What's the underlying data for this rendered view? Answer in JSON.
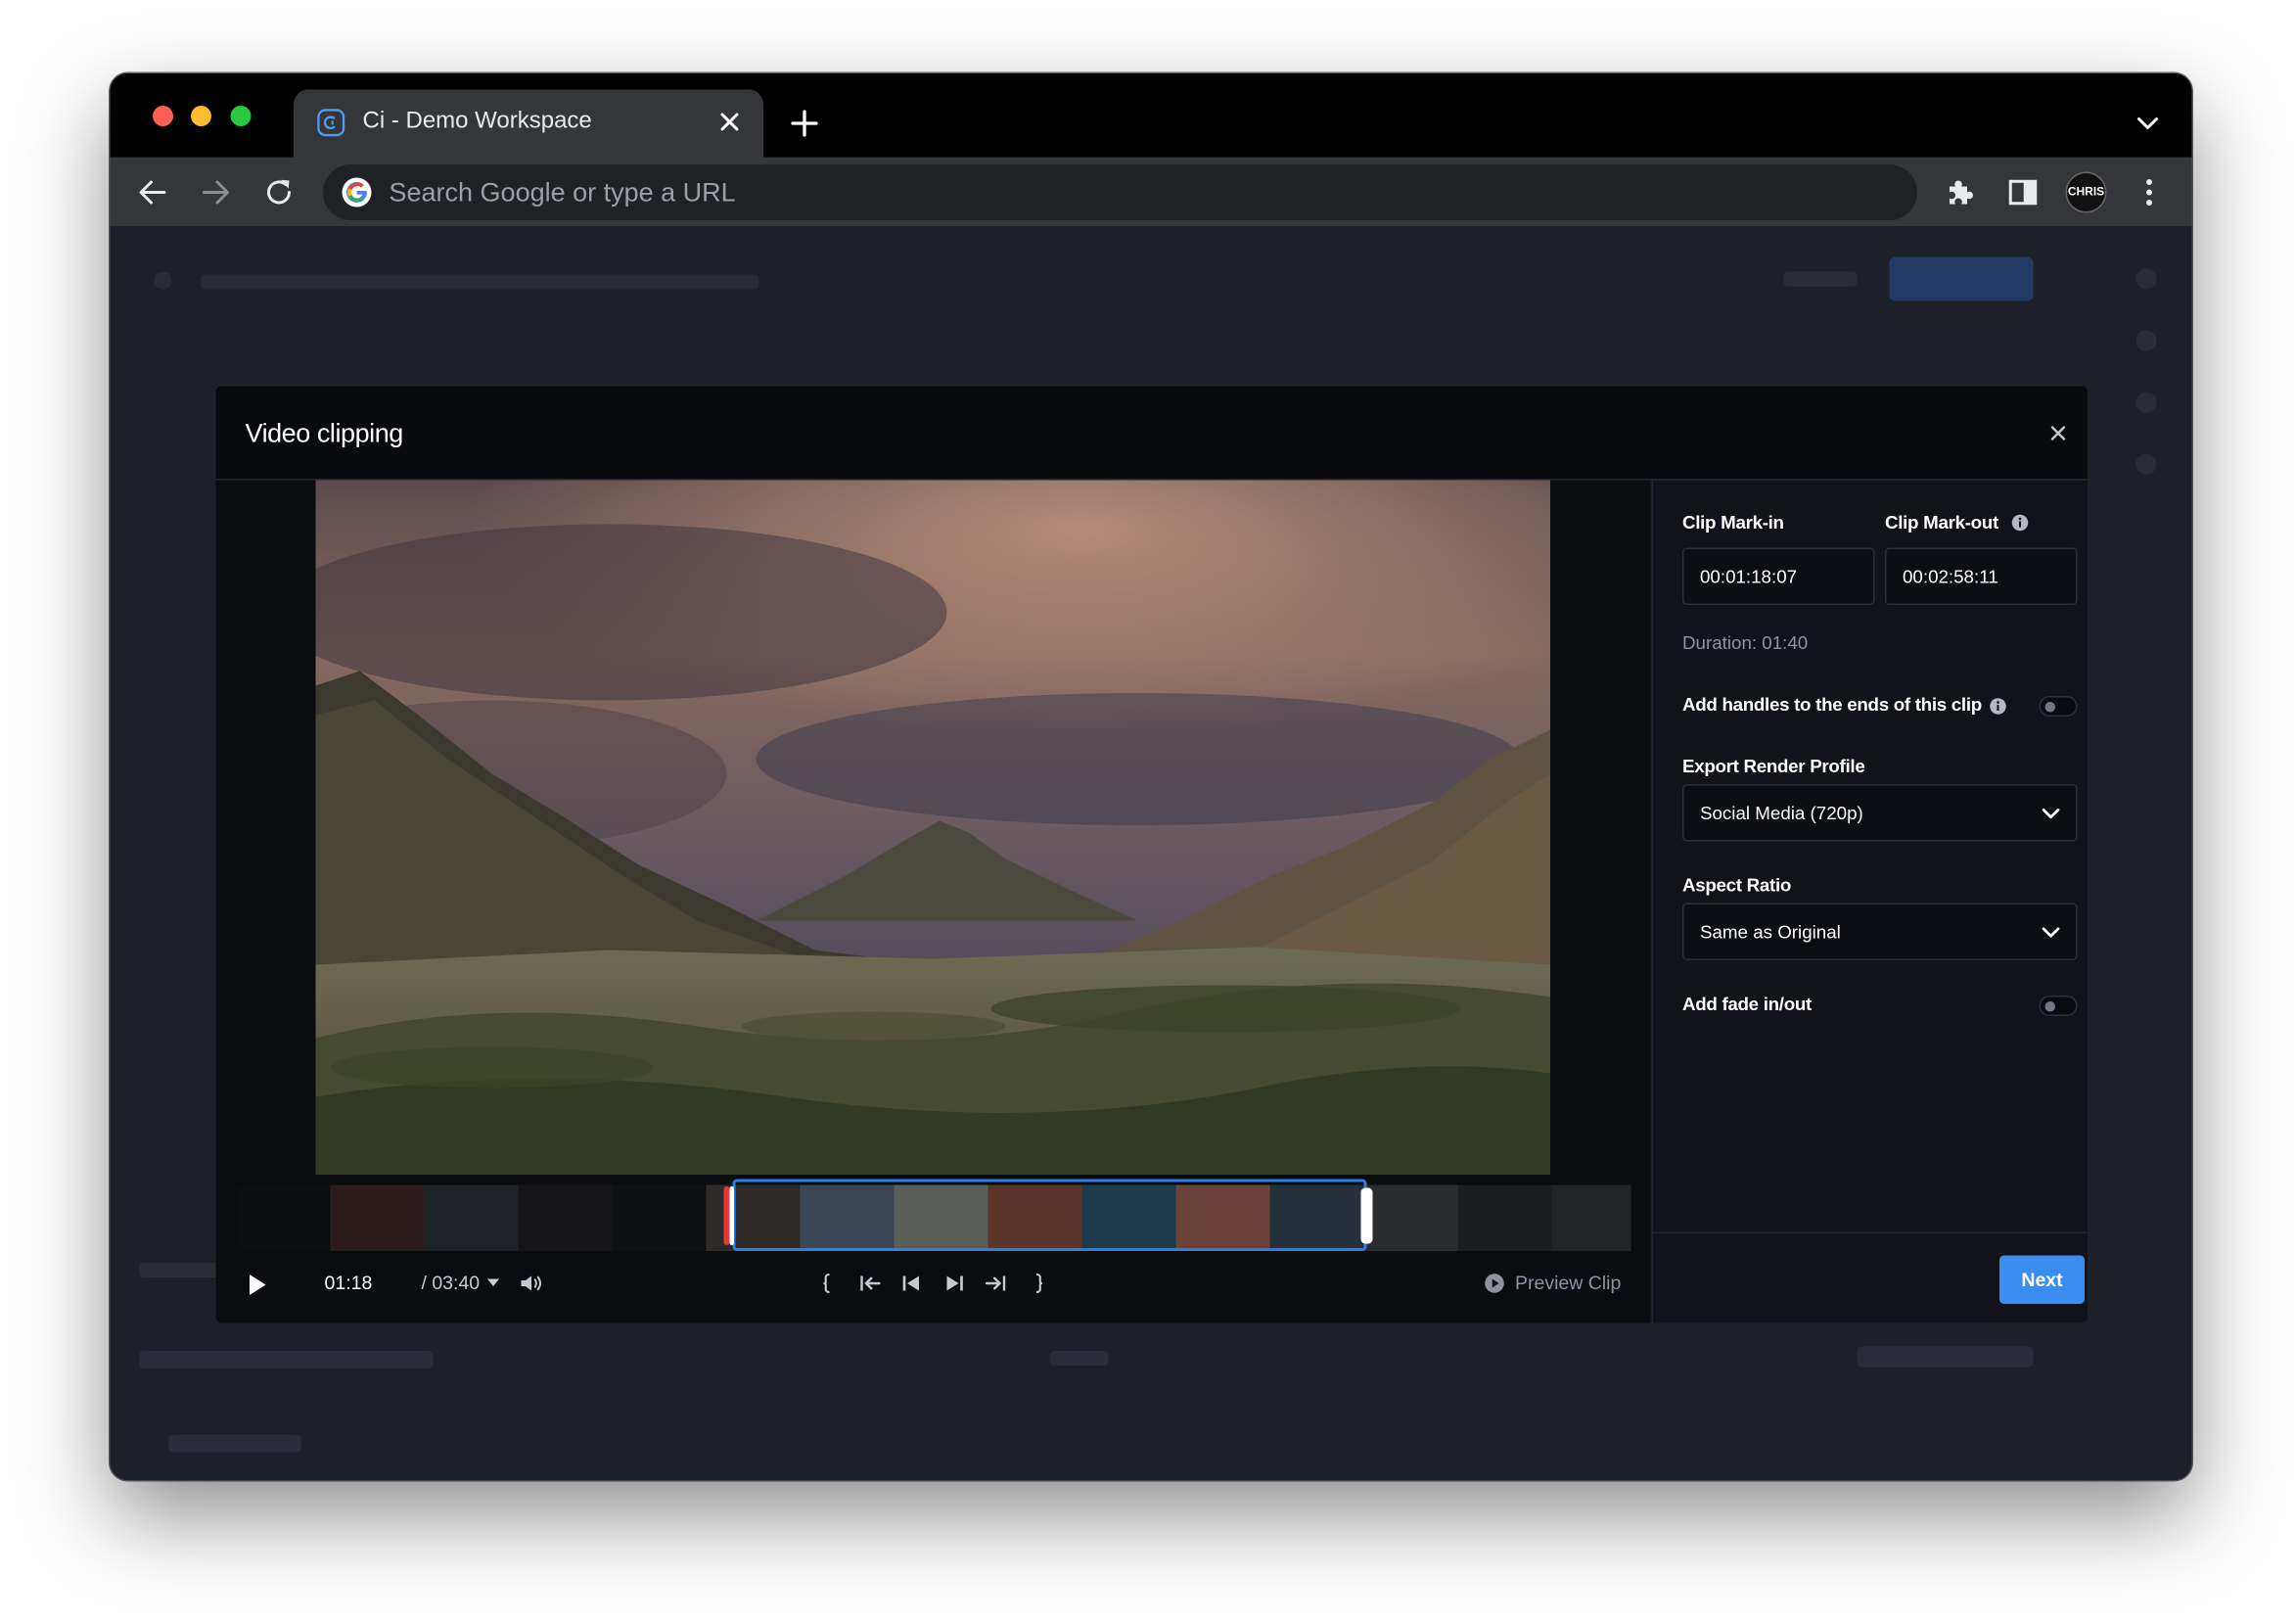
{
  "browser": {
    "tab_title": "Ci - Demo Workspace",
    "omnibox_placeholder": "Search Google or type a URL",
    "profile_label": "CHRIS"
  },
  "modal": {
    "title": "Video clipping"
  },
  "player": {
    "current_time": "01:18",
    "total_time": "/ 03:40",
    "preview_label": "Preview Clip"
  },
  "panel": {
    "mark_in_label": "Clip Mark-in",
    "mark_out_label": "Clip Mark-out",
    "mark_in_value": "00:01:18:07",
    "mark_out_value": "00:02:58:11",
    "duration": "Duration: 01:40",
    "handles_label": "Add handles to the ends of this clip",
    "handles_enabled": false,
    "render_profile_label": "Export Render Profile",
    "render_profile_value": "Social Media (720p)",
    "aspect_ratio_label": "Aspect Ratio",
    "aspect_ratio_value": "Same as Original",
    "fade_label": "Add fade in/out",
    "fade_enabled": false,
    "next_label": "Next"
  },
  "colors": {
    "accent": "#3a8ef0",
    "selection": "#2d7fe8",
    "markin_handle": "#e23a3a"
  }
}
